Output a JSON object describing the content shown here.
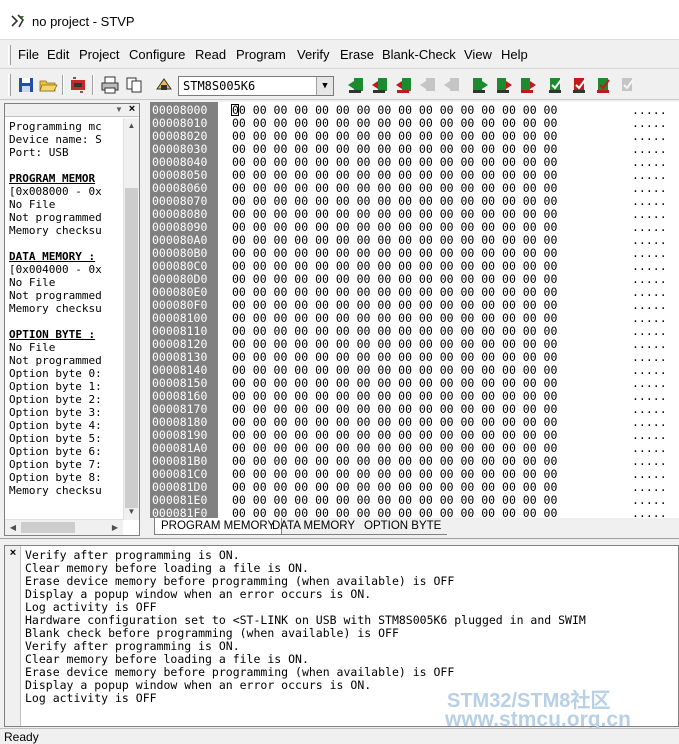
{
  "window": {
    "title": "no project - STVP"
  },
  "menu": [
    "File",
    "Edit",
    "Project",
    "Configure",
    "Read",
    "Program",
    "Verify",
    "Erase",
    "Blank-Check",
    "View",
    "Help"
  ],
  "toolbar": {
    "device": "STM8S005K6",
    "buttons": [
      "save-icon",
      "open-icon",
      "hardware-config-icon",
      "print-icon",
      "copy-icon",
      "device-config-icon"
    ]
  },
  "info_panel": {
    "lines": [
      {
        "t": "Programming mc",
        "h": false
      },
      {
        "t": "Device name: S",
        "h": false
      },
      {
        "t": "Port: USB",
        "h": false
      },
      {
        "t": "",
        "h": false
      },
      {
        "t": "PROGRAM MEMOR",
        "h": true
      },
      {
        "t": "[0x008000 - 0x",
        "h": false
      },
      {
        "t": "No File",
        "h": false
      },
      {
        "t": "Not programmed",
        "h": false
      },
      {
        "t": "Memory checksu",
        "h": false
      },
      {
        "t": "",
        "h": false
      },
      {
        "t": "DATA MEMORY :",
        "h": true
      },
      {
        "t": "[0x004000 - 0x",
        "h": false
      },
      {
        "t": "No File",
        "h": false
      },
      {
        "t": "Not programmed",
        "h": false
      },
      {
        "t": "Memory checksu",
        "h": false
      },
      {
        "t": "",
        "h": false
      },
      {
        "t": "OPTION BYTE :",
        "h": true
      },
      {
        "t": "No File",
        "h": false
      },
      {
        "t": "Not programmed",
        "h": false
      },
      {
        "t": "Option byte 0:",
        "h": false
      },
      {
        "t": "Option byte 1:",
        "h": false
      },
      {
        "t": "Option byte 2:",
        "h": false
      },
      {
        "t": "Option byte 3:",
        "h": false
      },
      {
        "t": "Option byte 4:",
        "h": false
      },
      {
        "t": "Option byte 5:",
        "h": false
      },
      {
        "t": "Option byte 6:",
        "h": false
      },
      {
        "t": "Option byte 7:",
        "h": false
      },
      {
        "t": "Option byte 8:",
        "h": false
      },
      {
        "t": "Memory checksu",
        "h": false
      }
    ]
  },
  "hex": {
    "addresses": [
      "00008000",
      "00008010",
      "00008020",
      "00008030",
      "00008040",
      "00008050",
      "00008060",
      "00008070",
      "00008080",
      "00008090",
      "000080A0",
      "000080B0",
      "000080C0",
      "000080D0",
      "000080E0",
      "000080F0",
      "00008100",
      "00008110",
      "00008120",
      "00008130",
      "00008140",
      "00008150",
      "00008160",
      "00008170",
      "00008180",
      "00008190",
      "000081A0",
      "000081B0",
      "000081C0",
      "000081D0",
      "000081E0",
      "000081F0"
    ],
    "bytes": "00 00 00 00 00 00 00 00 00 00 00 00 00 00 00 00",
    "ascii": "....."
  },
  "tabs": [
    "PROGRAM MEMORY",
    "DATA MEMORY",
    "OPTION BYTE"
  ],
  "log": [
    "Verify after programming is ON.",
    "Clear memory before loading a file is ON.",
    "Erase device memory before programming (when available) is OFF",
    "Display a popup window when an error occurs is ON.",
    "Log activity is OFF",
    "Hardware configuration set to <ST-LINK on USB with STM8S005K6 plugged in and SWIM",
    "Blank check before programming (when available) is OFF",
    "Verify after programming is ON.",
    "Clear memory before loading a file is ON.",
    "Erase device memory before programming (when available) is OFF",
    "Display a popup window when an error occurs is ON.",
    "Log activity is OFF"
  ],
  "watermark": {
    "line1": "STM32/STM8社区",
    "line2": "www.stmcu.org.cn"
  },
  "status": "Ready"
}
